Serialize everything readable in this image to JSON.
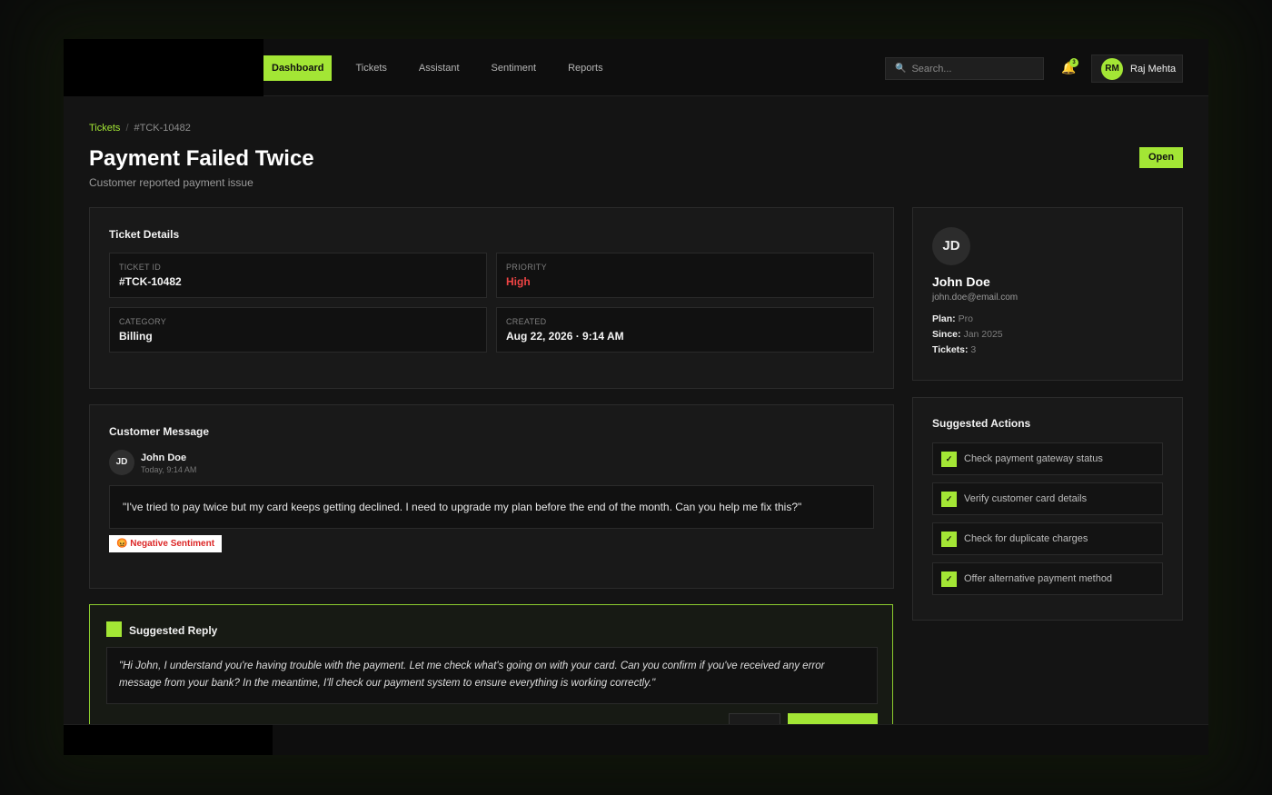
{
  "nav": {
    "items": [
      {
        "label": "Dashboard",
        "active": true
      },
      {
        "label": "Tickets"
      },
      {
        "label": "Assistant"
      },
      {
        "label": "Sentiment"
      },
      {
        "label": "Reports"
      }
    ],
    "search_placeholder": "Search...",
    "search_icon": "search-icon",
    "notification_count": "3",
    "user": {
      "initials": "RM",
      "name": "Raj Mehta"
    }
  },
  "breadcrumb": {
    "parent": "Tickets",
    "separator": "/",
    "current": "#TCK-10482"
  },
  "header": {
    "title": "Payment Failed Twice",
    "subtitle": "Customer reported payment issue",
    "status": "Open"
  },
  "ticket_details": {
    "title": "Ticket Details",
    "fields": [
      {
        "label": "TICKET ID",
        "value": "#TCK-10482"
      },
      {
        "label": "PRIORITY",
        "value": "High"
      },
      {
        "label": "CATEGORY",
        "value": "Billing"
      },
      {
        "label": "CREATED",
        "value": "Aug 22, 2026 · 9:14 AM"
      }
    ]
  },
  "customer_message": {
    "title": "Customer Message",
    "author_initials": "JD",
    "author": "John Doe",
    "time": "Today, 9:14 AM",
    "body": "\"I've tried to pay twice but my card keeps getting declined. I need to upgrade my plan before the end of the month. Can you help me fix this?\"",
    "sentiment": "😡 Negative Sentiment"
  },
  "suggested_reply": {
    "title": "Suggested Reply",
    "body": "\"Hi John, I understand you're having trouble with the payment. Let me check what's going on with your card. Can you confirm if you've received any error message from your bank? In the meantime, I'll check our payment system to ensure everything is working correctly.\""
  },
  "customer_profile": {
    "initials": "JD",
    "name": "John Doe",
    "email": "john.doe@email.com",
    "plan_label": "Plan:",
    "plan": "Pro",
    "since_label": "Since:",
    "since": "Jan 2025",
    "tickets_label": "Tickets:",
    "tickets": "3"
  },
  "suggested_actions": {
    "title": "Suggested Actions",
    "check_glyph": "✓",
    "items": [
      "Check payment gateway status",
      "Verify customer card details",
      "Check for duplicate charges",
      "Offer alternative payment method"
    ]
  },
  "colors": {
    "accent": "#a3e635",
    "danger": "#ef4444",
    "background": "#141414",
    "card": "#191919"
  }
}
